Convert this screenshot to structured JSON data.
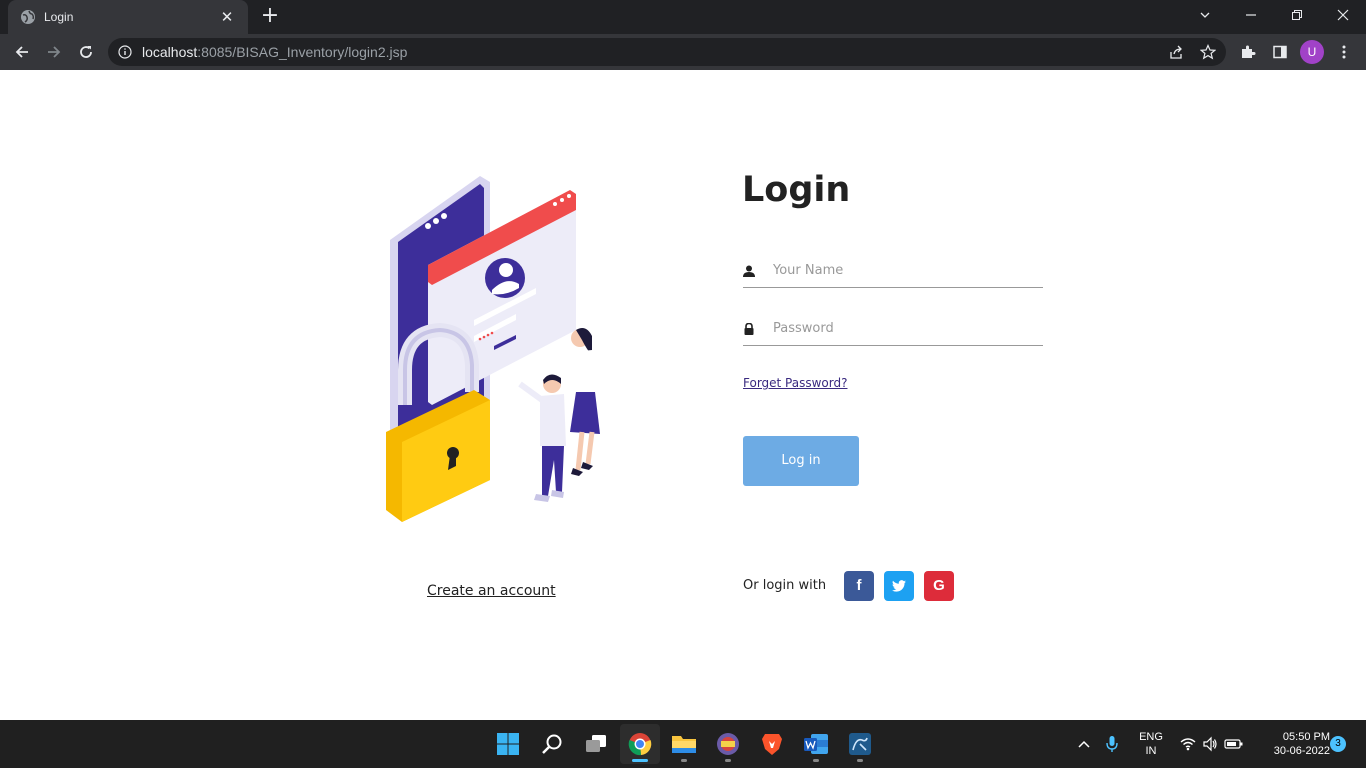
{
  "browser": {
    "tab_title": "Login",
    "tab_close": "✕",
    "new_tab": "+",
    "url_host": "localhost",
    "url_rest": ":8085/BISAG_Inventory/login2.jsp",
    "profile_initial": "U"
  },
  "login": {
    "title": "Login",
    "username_placeholder": "Your Name",
    "password_placeholder": "Password",
    "forget_password": "Forget Password?",
    "login_button": "Log in",
    "create_account": "Create an account",
    "or_login_with": "Or login with",
    "social": {
      "facebook": "f",
      "google": "G"
    }
  },
  "colors": {
    "login_button": "#6dabe4",
    "facebook": "#3b5998",
    "twitter": "#1da1f2",
    "google": "#dd2c3a"
  },
  "taskbar": {
    "language_line1": "ENG",
    "language_line2": "IN",
    "time": "05:50 PM",
    "date": "30-06-2022",
    "notification_count": "3"
  }
}
